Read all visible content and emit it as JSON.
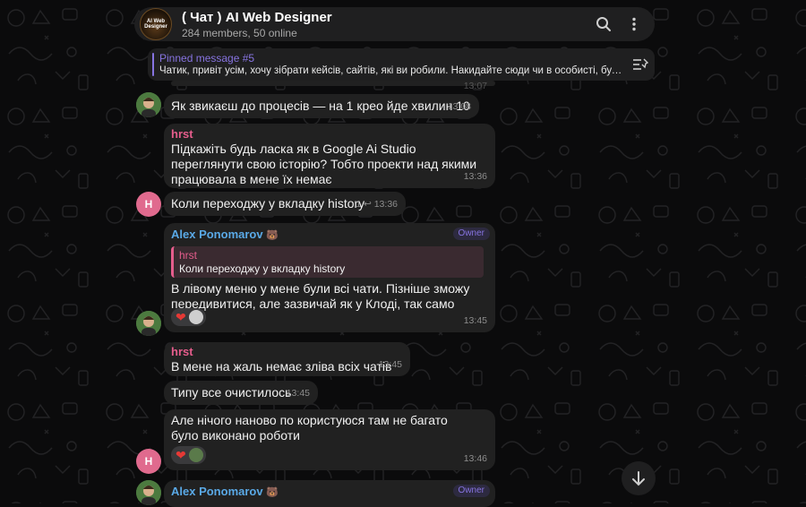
{
  "header": {
    "avatar_text": "AI Web Designer",
    "title": "( Чат ) AI Web Designer",
    "subtitle": "284 members, 50 online",
    "search_icon": "search-icon",
    "menu_icon": "more-vertical-icon"
  },
  "pinned": {
    "title": "Pinned message #5",
    "text": "Чатик, привіт усім, хочу зібрати кейсів, сайтів, які ви робили. Накидайте сюди чи в особисті, будь ...",
    "icon": "pinned-list-icon"
  },
  "top_partial": {
    "time": "13:07"
  },
  "messages": [
    {
      "text": "Як звикаєш до процесів — на 1 крео йде хвилин 10",
      "time": "13:08"
    },
    {
      "sender": "hrst",
      "text": "Підкажіть будь ласка як в Google Ai Studio переглянути свою історію? Тобто проекти над якими працювала в мене їх немає",
      "time": "13:36"
    },
    {
      "avatar_letter": "H",
      "text": "Коли переходжу у вкладку history",
      "reply_count": "1",
      "time": "13:36"
    },
    {
      "sender": "Alex Ponomarov",
      "badge": "Owner",
      "reply_sender": "hrst",
      "reply_text": "Коли переходжу у вкладку history",
      "text": "В лівому меню у мене були всі чати. Пізніше зможу передивитися, але зазвичай як у Клоді, так само",
      "time": "13:45"
    },
    {
      "sender": "hrst",
      "text": "В мене на жаль немає зліва всіх чатів",
      "time": "13:45"
    },
    {
      "text": "Типу все очистилось",
      "time": "13:45"
    },
    {
      "avatar_letter": "H",
      "text": "Але нічого наново по користуюся там не багато було виконано роботи",
      "time": "13:46"
    },
    {
      "sender": "Alex Ponomarov",
      "badge": "Owner"
    }
  ],
  "colors": {
    "accent": "#8774e1",
    "pink_sender": "#e55d8c",
    "blue_sender": "#5aa9e6",
    "bubble": "#212121"
  },
  "scroll_icon": "arrow-down-icon"
}
